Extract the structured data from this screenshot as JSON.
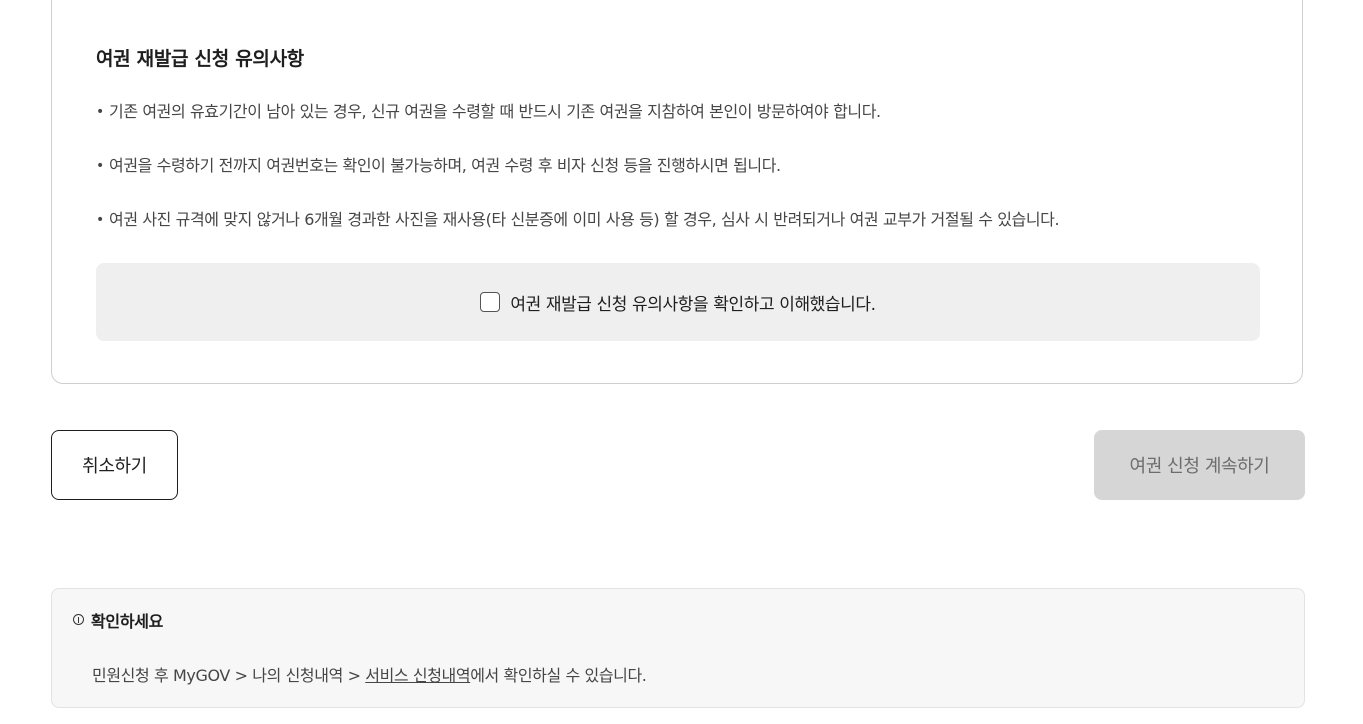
{
  "notice": {
    "title": "여권 재발급 신청 유의사항",
    "bullet": "•",
    "items": [
      "기존 여권의 유효기간이 남아 있는 경우, 신규 여권을 수령할 때 반드시 기존 여권을 지참하여 본인이 방문하여야 합니다.",
      "여권을 수령하기 전까지 여권번호는 확인이 불가능하며, 여권 수령 후 비자 신청 등을 진행하시면 됩니다.",
      "여권 사진 규격에 맞지 않거나 6개월 경과한 사진을 재사용(타 신분증에 이미 사용 등) 할 경우, 심사 시 반려되거나 여권 교부가 거절될 수 있습니다."
    ],
    "confirm_label": "여권 재발급 신청 유의사항을 확인하고 이해했습니다.",
    "confirm_checked": false
  },
  "actions": {
    "cancel_label": "취소하기",
    "continue_label": "여권 신청 계속하기"
  },
  "info": {
    "title": "확인하세요",
    "icon": "info-circle-icon",
    "text_before": "민원신청 후 MyGOV > 나의 신청내역 > ",
    "link_text": "서비스 신청내역",
    "text_after": "에서 확인하실 수 있습니다."
  }
}
